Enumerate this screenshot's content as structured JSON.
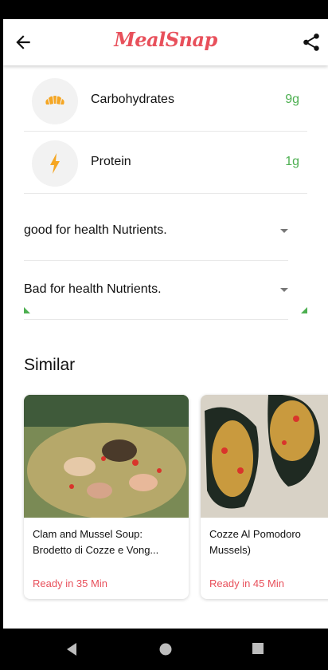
{
  "app": {
    "title": "MealSnap"
  },
  "nutrients": [
    {
      "name": "Carbohydrates",
      "value": "9g",
      "icon": "croissant-icon"
    },
    {
      "name": "Protein",
      "value": "1g",
      "icon": "lightning-icon"
    }
  ],
  "sections": {
    "good_label": "good for health Nutrients.",
    "bad_label": "Bad for health Nutrients."
  },
  "similar": {
    "title": "Similar",
    "recipes": [
      {
        "title_line1": "Clam and Mussel Soup:",
        "title_line2": "Brodetto di Cozze e Vong...",
        "ready": "Ready in 35 Min"
      },
      {
        "title_line1": "Cozze Al Pomodoro",
        "title_line2": "Mussels)",
        "ready": "Ready in 45 Min"
      }
    ]
  },
  "colors": {
    "brand": "#e8505b",
    "nutrient_value": "#4caf50",
    "icon_orange": "#f5a623"
  }
}
